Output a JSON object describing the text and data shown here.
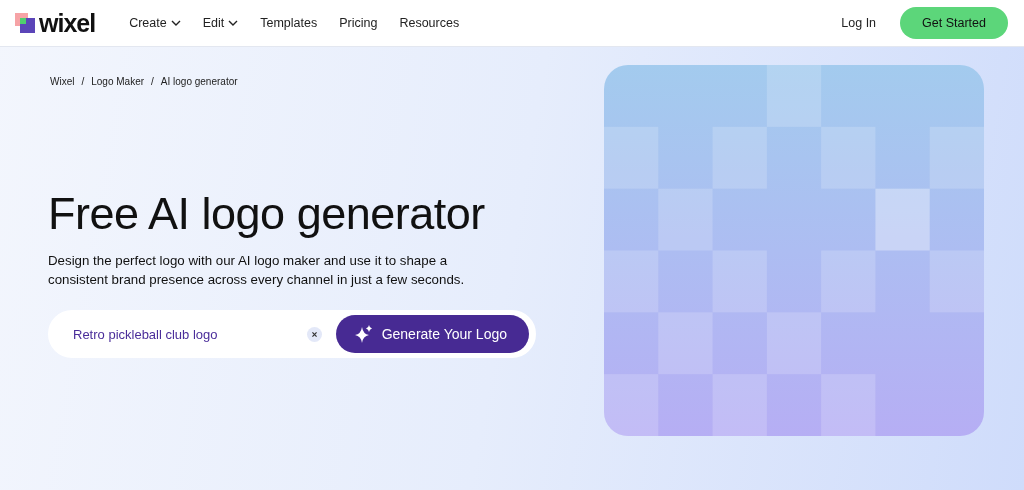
{
  "header": {
    "brand": "wixel",
    "nav": [
      {
        "label": "Create",
        "dropdown": true
      },
      {
        "label": "Edit",
        "dropdown": true
      },
      {
        "label": "Templates",
        "dropdown": false
      },
      {
        "label": "Pricing",
        "dropdown": false
      },
      {
        "label": "Resources",
        "dropdown": false
      }
    ],
    "login": "Log In",
    "cta": "Get Started"
  },
  "breadcrumb": {
    "items": [
      "Wixel",
      "Logo Maker",
      "AI logo generator"
    ],
    "separators": [
      "/",
      "/"
    ]
  },
  "hero": {
    "title": "Free AI logo generator",
    "description": "Design the perfect logo with our AI logo maker and use it to shape a consistent brand presence across every channel in just a few seconds.",
    "prompt": {
      "value": "Retro pickleball club logo",
      "button": "Generate Your Logo"
    }
  }
}
